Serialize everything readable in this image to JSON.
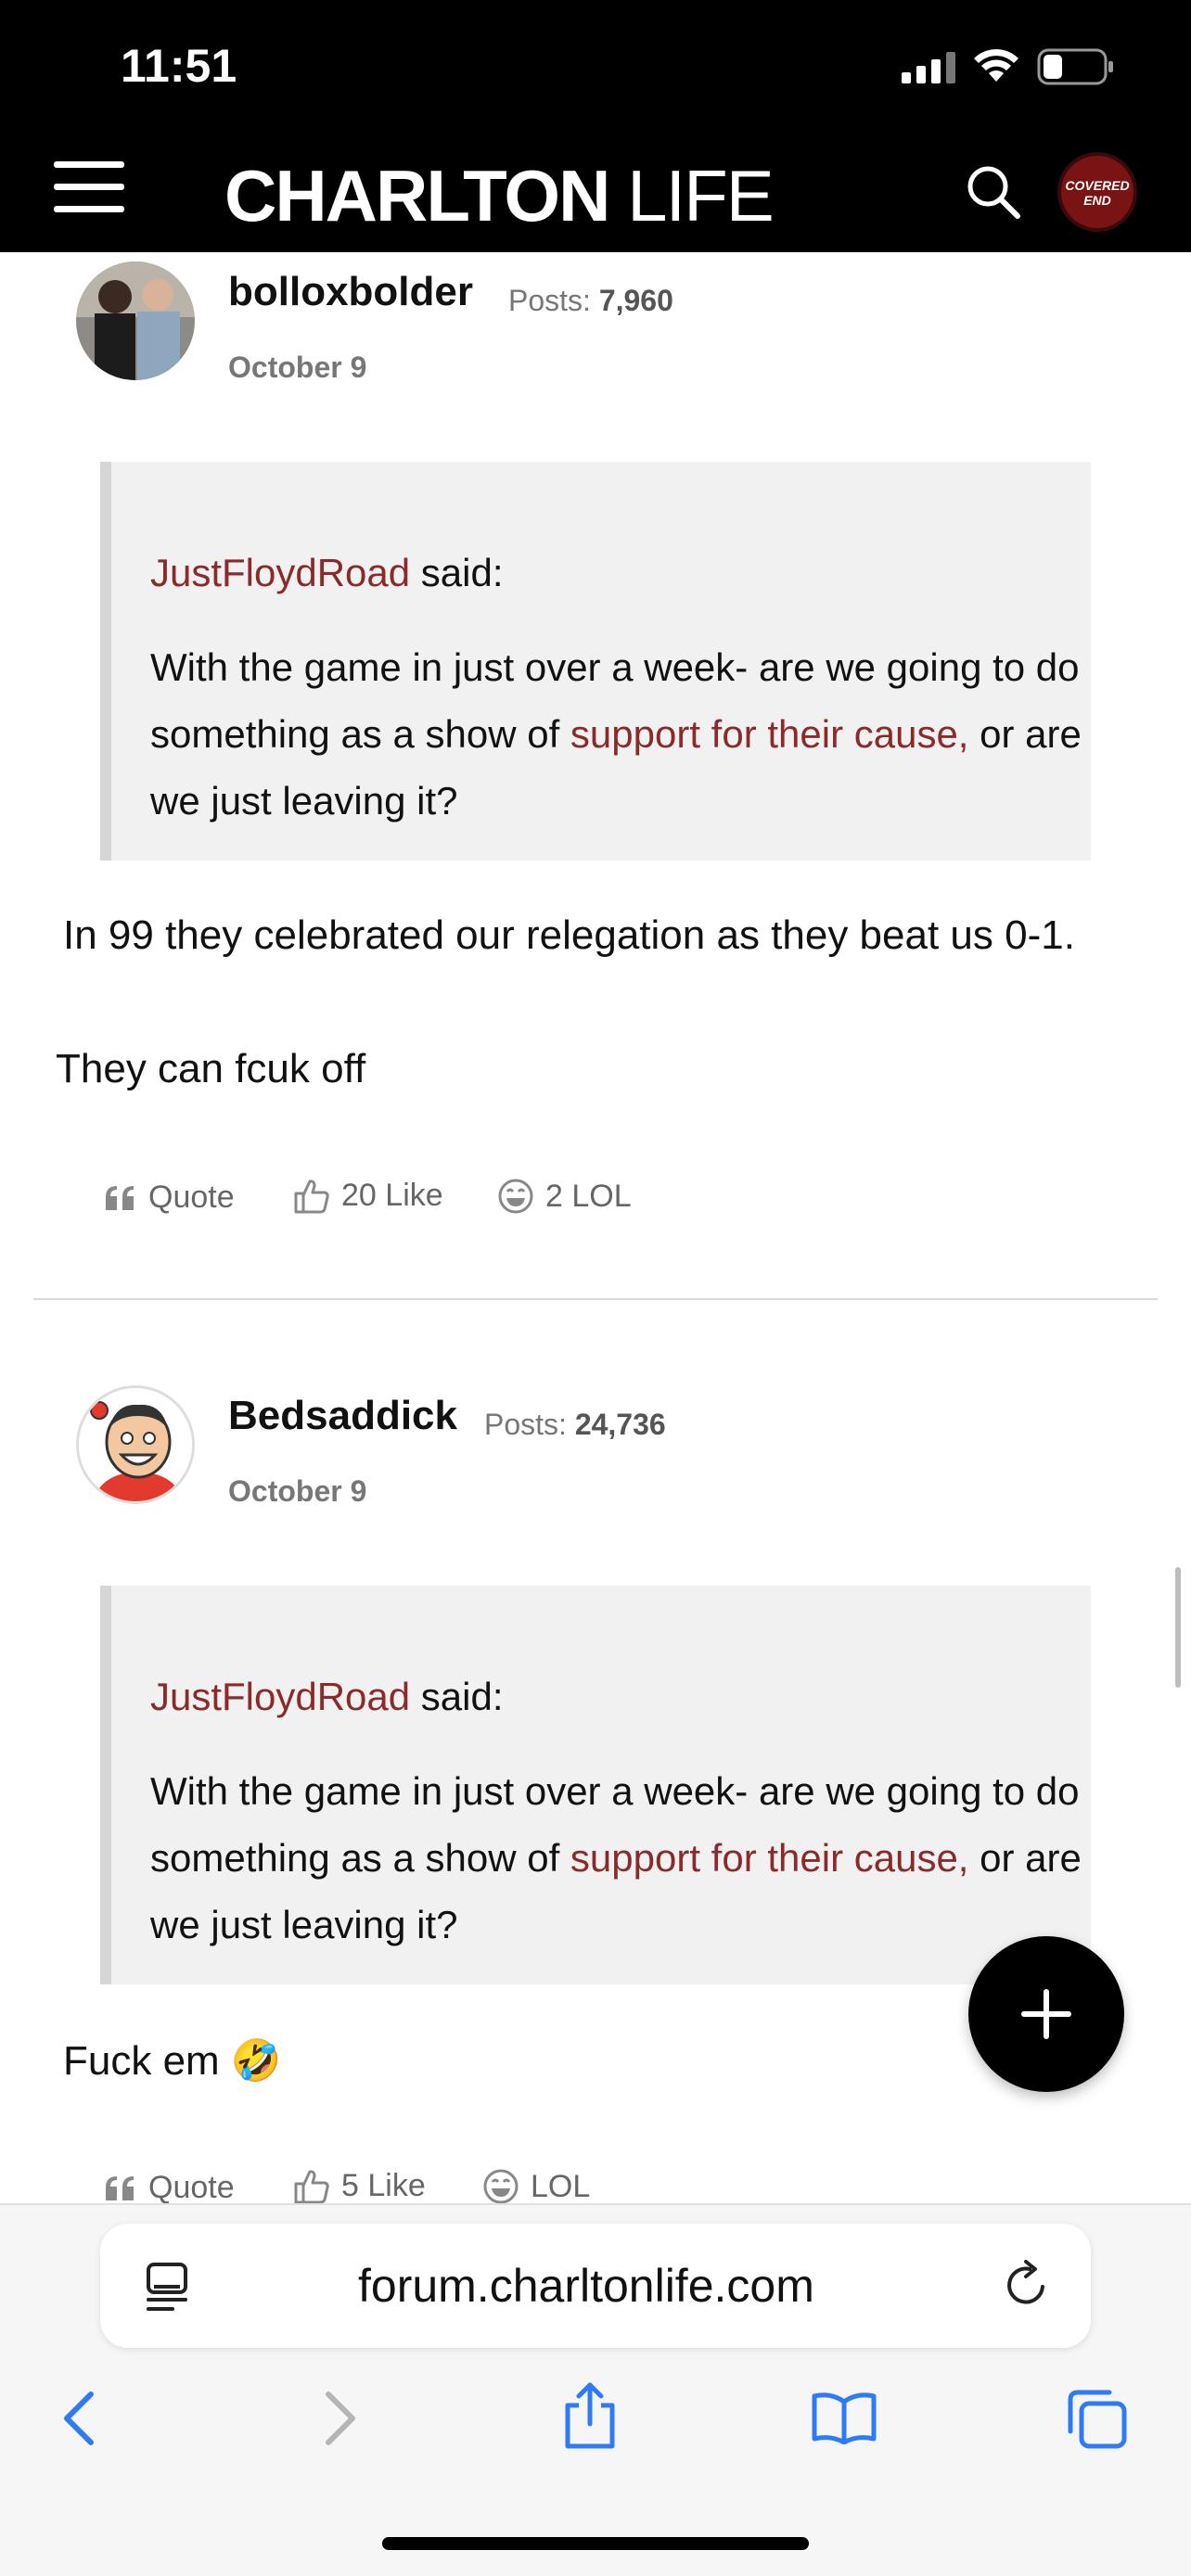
{
  "status_bar": {
    "time": "11:51"
  },
  "header": {
    "logo_bold": "CHARLTON",
    "logo_light": " LIFE",
    "avatar_text": "COVERED END"
  },
  "posts": [
    {
      "username": "bolloxbolder",
      "posts_label": "Posts: ",
      "posts_count": "7,960",
      "date": "October 9",
      "quote": {
        "author": "JustFloydRoad",
        "said": " said:",
        "text_before": "With the game in just over a week- are we going to do something as a show of ",
        "text_link": "support for their cause,",
        "text_after": " or are we just leaving it?"
      },
      "body": [
        "In 99 they celebrated our relegation as they beat us 0-1.",
        "They can fcuk off"
      ],
      "reactions": {
        "quote": "Quote",
        "like_count": "20",
        "like": "Like",
        "lol_count": "2",
        "lol": "LOL"
      }
    },
    {
      "username": "Bedsaddick",
      "posts_label": "Posts: ",
      "posts_count": "24,736",
      "date": "October 9",
      "quote": {
        "author": "JustFloydRoad",
        "said": " said:",
        "text_before": "With the game in just over a week- are we going to do something as a show of ",
        "text_link": "support for their cause,",
        "text_after": " or are we just leaving it?"
      },
      "body": [
        "Fuck em 🤣"
      ],
      "reactions": {
        "quote": "Quote",
        "like_count": "5",
        "like": "Like",
        "lol": "LOL"
      }
    }
  ],
  "browser": {
    "url": "forum.charltonlife.com"
  },
  "colors": {
    "accent_link": "#8a2a2a",
    "header_bg": "#000000",
    "browser_blue": "#2f7bf5"
  }
}
